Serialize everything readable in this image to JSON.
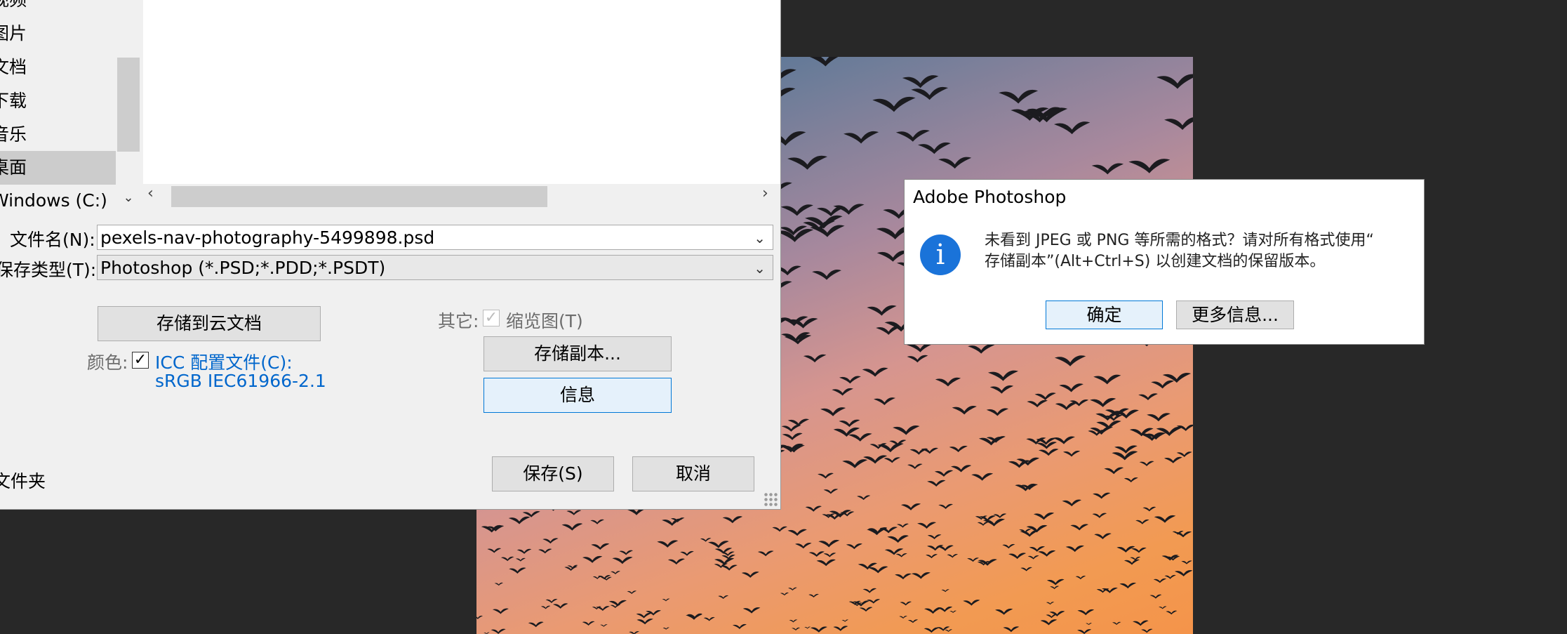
{
  "save_dialog": {
    "nav_items": [
      "视频",
      "图片",
      "文档",
      "下载",
      "音乐",
      "桌面",
      "Windows (C:)"
    ],
    "selected_nav": "桌面",
    "filename_label": "文件名(N):",
    "filename_value": "pexels-nav-photography-5499898.psd",
    "filetype_label": "保存类型(T):",
    "filetype_value": "Photoshop (*.PSD;*.PDD;*.PSDT)",
    "save_to_cloud": "存储到云文档",
    "color_label": "颜色:",
    "icc_label": "ICC 配置文件(C):",
    "icc_profile": "sRGB IEC61966-2.1",
    "other_label": "其它:",
    "thumbnail_label": "缩览图(T)",
    "save_copy": "存储副本...",
    "info": "信息",
    "save": "保存(S)",
    "cancel": "取消",
    "folder_label": "文件夹"
  },
  "alert": {
    "title": "Adobe Photoshop",
    "message_line1": "未看到 JPEG 或 PNG 等所需的格式？请对所有格式使用“",
    "message_line2": "存储副本”(Alt+Ctrl+S) 以创建文档的保留版本。",
    "ok": "确定",
    "more_info": "更多信息..."
  }
}
